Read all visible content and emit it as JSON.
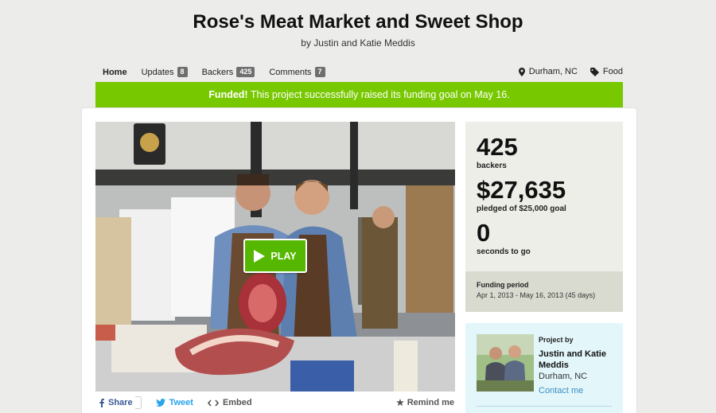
{
  "project": {
    "title": "Rose's Meat Market and Sweet Shop",
    "byline": "by Justin and Katie Meddis"
  },
  "nav": {
    "home": "Home",
    "updates": "Updates",
    "updates_count": "8",
    "backers": "Backers",
    "backers_count": "425",
    "comments": "Comments",
    "comments_count": "7",
    "location": "Durham, NC",
    "category": "Food"
  },
  "banner": {
    "funded_word": "Funded!",
    "message": " This project successfully raised its funding goal on May 16."
  },
  "video": {
    "play_label": "PLAY"
  },
  "share": {
    "share_label": "Share",
    "tweet_label": "Tweet",
    "embed_label": "Embed",
    "remind_label": "Remind me"
  },
  "stats": {
    "backers_value": "425",
    "backers_label": "backers",
    "pledged_value": "$27,635",
    "pledged_label": "pledged of $25,000 goal",
    "time_value": "0",
    "time_label": "seconds to go"
  },
  "funding_period": {
    "label": "Funding period",
    "value": "Apr 1, 2013 - May 16, 2013 (45 days)"
  },
  "creator": {
    "label": "Project by",
    "name": "Justin and Katie Meddis",
    "location": "Durham, NC",
    "contact": "Contact me"
  },
  "colors": {
    "funded_green": "#78c800",
    "play_green": "#55b700",
    "facebook_blue": "#3b5998",
    "twitter_blue": "#2aa3ef",
    "link_blue": "#3b8fc4"
  }
}
